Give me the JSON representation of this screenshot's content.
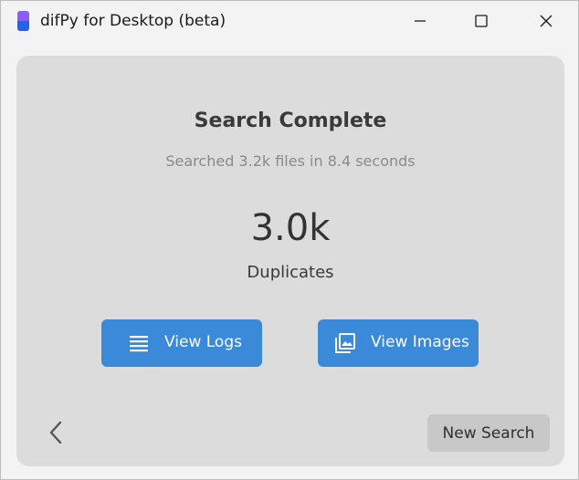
{
  "window": {
    "title": "difPy for Desktop (beta)"
  },
  "results": {
    "heading": "Search Complete",
    "subtitle": "Searched 3.2k files in 8.4 seconds",
    "count": "3.0k",
    "count_label": "Duplicates"
  },
  "actions": {
    "view_logs": {
      "label": "View Logs",
      "icon": "list-icon"
    },
    "view_images": {
      "label": "View Images",
      "icon": "images-icon"
    },
    "new_search": {
      "label": "New Search"
    },
    "back": {
      "icon": "chevron-left-icon"
    }
  },
  "colors": {
    "primary_button": "#3b8ad9",
    "card_background": "#dcdcdc",
    "secondary_button": "#c8c8c8",
    "app_icon_top": "#8b5cf6",
    "app_icon_bottom": "#2563eb"
  }
}
